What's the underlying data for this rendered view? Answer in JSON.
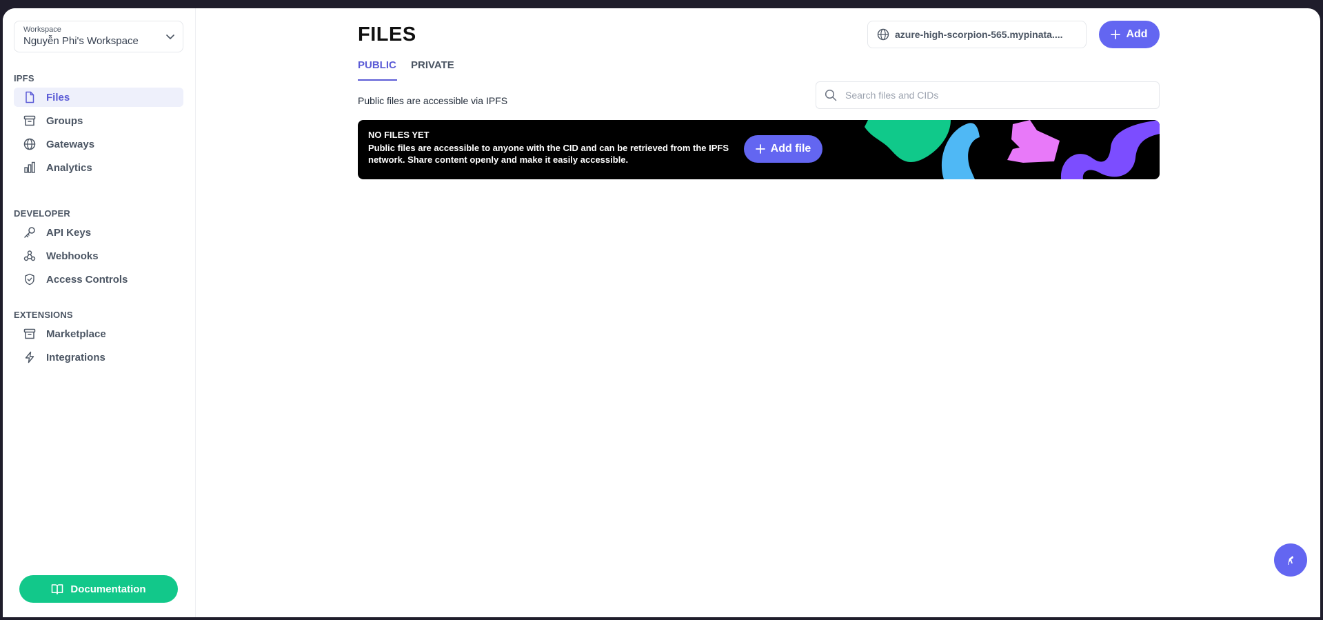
{
  "sidebar": {
    "workspace": {
      "caption": "Workspace",
      "name": "Nguyễn Phi's Workspace"
    },
    "sections": {
      "ipfs": "IPFS",
      "developer": "DEVELOPER",
      "extensions": "EXTENSIONS"
    },
    "items": {
      "files": "Files",
      "groups": "Groups",
      "gateways": "Gateways",
      "analytics": "Analytics",
      "api_keys": "API Keys",
      "webhooks": "Webhooks",
      "access_controls": "Access Controls",
      "marketplace": "Marketplace",
      "integrations": "Integrations"
    },
    "documentation_label": "Documentation"
  },
  "main": {
    "title": "FILES",
    "tabs": {
      "public": "PUBLIC",
      "private": "PRIVATE"
    },
    "subtitle": "Public files are accessible via IPFS",
    "gateway": "azure-high-scorpion-565.mypinata....",
    "add_label": "Add",
    "search_placeholder": "Search files and CIDs",
    "banner": {
      "title": "NO FILES YET",
      "text": "Public files are accessible to anyone with the CID and can be retrieved from the IPFS network. Share content openly and make it easily accessible.",
      "add_file_label": "Add file"
    }
  },
  "colors": {
    "accent": "#6366f1",
    "active_text": "#5b5bd6",
    "documentation": "#12c88a"
  }
}
